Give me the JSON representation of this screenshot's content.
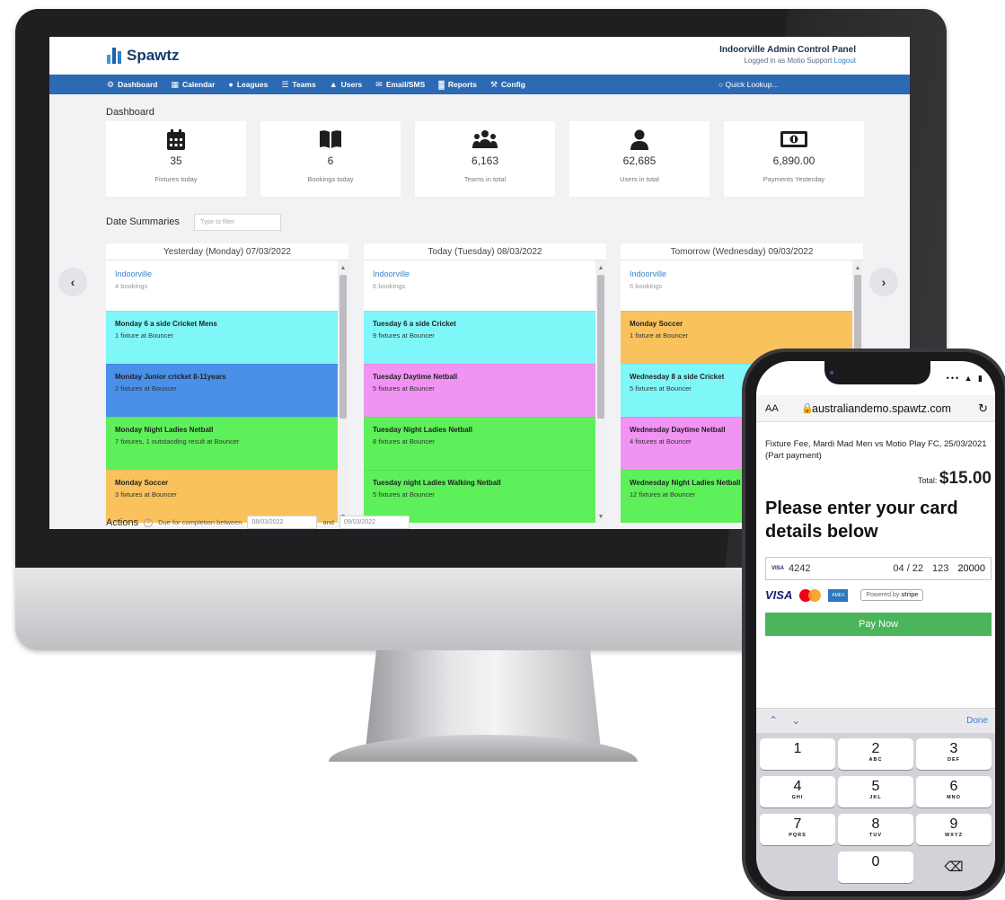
{
  "app": {
    "logo_text": "Spawtz",
    "admin_title": "Indoorville Admin Control Panel",
    "admin_logged_in": "Logged in as Motio Support",
    "admin_logout": "Logout"
  },
  "nav": {
    "items": [
      {
        "label": "Dashboard",
        "icon": "dashboard-icon",
        "glyph": "⚙"
      },
      {
        "label": "Calendar",
        "icon": "calendar-icon",
        "glyph": "▦"
      },
      {
        "label": "Leagues",
        "icon": "leagues-icon",
        "glyph": "●"
      },
      {
        "label": "Teams",
        "icon": "teams-icon",
        "glyph": "☰"
      },
      {
        "label": "Users",
        "icon": "user-icon",
        "glyph": "▲"
      },
      {
        "label": "Email/SMS",
        "icon": "envelope-icon",
        "glyph": "✉"
      },
      {
        "label": "Reports",
        "icon": "chart-icon",
        "glyph": "▓"
      },
      {
        "label": "Config",
        "icon": "wrench-icon",
        "glyph": "⚒"
      }
    ],
    "quick_lookup": "Quick Lookup..."
  },
  "dashboard": {
    "title": "Dashboard",
    "stats": [
      {
        "value": "35",
        "label": "Fixtures today",
        "icon": "calendar-icon"
      },
      {
        "value": "6",
        "label": "Bookings today",
        "icon": "book-icon"
      },
      {
        "value": "6,163",
        "label": "Teams in total",
        "icon": "team-icon"
      },
      {
        "value": "62,685",
        "label": "Users in total",
        "icon": "user-icon"
      },
      {
        "value": "6,890.00",
        "label": "Payments Yesterday",
        "icon": "money-icon"
      }
    ]
  },
  "date_summaries": {
    "title": "Date Summaries",
    "filter_placeholder": "Type to filter",
    "days": [
      {
        "header": "Yesterday (Monday) 07/03/2022",
        "venue": "Indoorville",
        "bookings": "4 bookings",
        "events": [
          {
            "name": "Monday 6 a side Cricket Mens",
            "desc": "1 fixture at Bouncer",
            "color": "#7ff7f8"
          },
          {
            "name": "Monday Junior cricket 8-11years",
            "desc": "2 fixtures at Bouncer",
            "color": "#4a90e8"
          },
          {
            "name": "Monday Night Ladies Netball",
            "desc": "7 fixtures, 1 outstanding result at Bouncer",
            "color": "#5ef05a"
          },
          {
            "name": "Monday Soccer",
            "desc": "3 fixtures at Bouncer",
            "color": "#f9c25c"
          }
        ]
      },
      {
        "header": "Today (Tuesday) 08/03/2022",
        "venue": "Indoorville",
        "bookings": "6 bookings",
        "events": [
          {
            "name": "Tuesday 6 a side Cricket",
            "desc": "9 fixtures at Bouncer",
            "color": "#7ff7f8"
          },
          {
            "name": "Tuesday Daytime Netball",
            "desc": "5 fixtures at Bouncer",
            "color": "#f193f3"
          },
          {
            "name": "Tuesday Night Ladies Netball",
            "desc": "8 fixtures at Bouncer",
            "color": "#5ef05a"
          },
          {
            "name": "Tuesday night Ladies Walking Netball",
            "desc": "5 fixtures at Bouncer",
            "color": "#5ef05a"
          }
        ]
      },
      {
        "header": "Tomorrow (Wednesday) 09/03/2022",
        "venue": "Indoorville",
        "bookings": "6 bookings",
        "events": [
          {
            "name": "Monday Soccer",
            "desc": "1 fixture at Bouncer",
            "color": "#f9c25c"
          },
          {
            "name": "Wednesday 8 a side Cricket",
            "desc": "5 fixtures at Bouncer",
            "color": "#7ff7f8"
          },
          {
            "name": "Wednesday Daytime Netball",
            "desc": "4 fixtures at Bouncer",
            "color": "#f193f3"
          },
          {
            "name": "Wednesday Night Ladies Netball",
            "desc": "12 fixtures at Bouncer",
            "color": "#5ef05a"
          }
        ]
      }
    ]
  },
  "actions": {
    "title": "Actions",
    "due_text": "Due for completion between",
    "from_date": "08/03/2022",
    "and_text": "and",
    "to_date": "09/03/2022"
  },
  "phone": {
    "url_aa": "AA",
    "url": "australiandemo.spawtz.com",
    "fee_text": "Fixture Fee, Mardi Mad Men vs Motio Play FC, 25/03/2021 (Part payment)",
    "total_label": "Total:",
    "total_amount": "$15.00",
    "headline": "Please enter your card details below",
    "card_brand_mini": "VISA",
    "card_number": "4242",
    "card_expiry": "04 / 22",
    "card_cvc": "123",
    "card_zip": "20000",
    "brand_visa": "VISA",
    "brand_amex": "AMEX",
    "powered_by": "Powered by",
    "stripe": "stripe",
    "pay_button": "Pay Now",
    "kb_done": "Done",
    "keys": [
      {
        "n": "1",
        "l": ""
      },
      {
        "n": "2",
        "l": "ABC"
      },
      {
        "n": "3",
        "l": "DEF"
      },
      {
        "n": "4",
        "l": "GHI"
      },
      {
        "n": "5",
        "l": "JKL"
      },
      {
        "n": "6",
        "l": "MNO"
      },
      {
        "n": "7",
        "l": "PQRS"
      },
      {
        "n": "8",
        "l": "TUV"
      },
      {
        "n": "9",
        "l": "WXYZ"
      },
      {
        "n": "",
        "l": ""
      },
      {
        "n": "0",
        "l": ""
      },
      {
        "n": "⌫",
        "l": ""
      }
    ]
  },
  "colors": {
    "nav_blue": "#2c6ab3",
    "pay_green": "#4bb55b"
  }
}
